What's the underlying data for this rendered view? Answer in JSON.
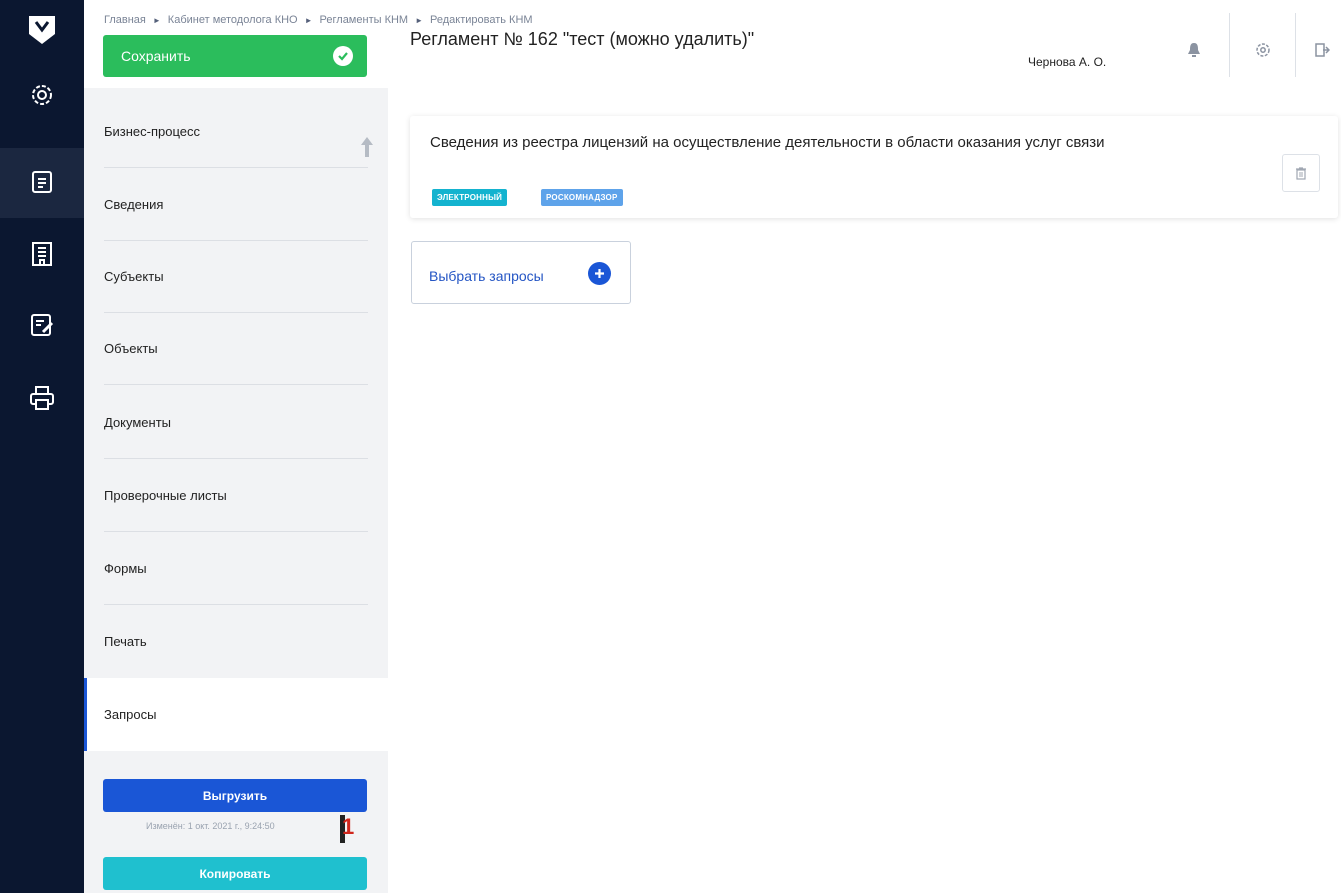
{
  "breadcrumb": [
    "Главная",
    "Кабинет методолога КНО",
    "Регламенты КНМ",
    "Редактировать КНМ"
  ],
  "breadcrumb_separator": "►",
  "header": {
    "save_label": "Сохранить",
    "title": "Регламент № 162 \"тест (можно удалить)\"",
    "user": "Чернова А. О."
  },
  "rail": {
    "items": [
      "logo-icon",
      "settings-icon",
      "document-icon",
      "building-icon",
      "edit-list-icon",
      "print-icon"
    ],
    "active": "document-icon"
  },
  "sections": {
    "items": [
      {
        "label": "Бизнес-процесс"
      },
      {
        "label": "Сведения"
      },
      {
        "label": "Субъекты"
      },
      {
        "label": "Объекты"
      },
      {
        "label": "Документы"
      },
      {
        "label": "Проверочные листы"
      },
      {
        "label": "Формы"
      },
      {
        "label": "Печать"
      },
      {
        "label": "Запросы"
      }
    ],
    "active": "Запросы"
  },
  "actions": {
    "export_label": "Выгрузить",
    "modified": "Изменён: 1 окт. 2021 г., 9:24:50",
    "copy_label": "Копировать"
  },
  "annotation": "1",
  "request": {
    "title": "Сведения из реестра лицензий на осуществление деятельности в области оказания услуг связи",
    "tags": [
      "ЭЛЕКТРОННЫЙ",
      "РОСКОМНАДЗОР"
    ]
  },
  "pick_label": "Выбрать запросы",
  "colors": {
    "rail": "#0b1730",
    "save": "#2bbd5c",
    "primary": "#1a56d6",
    "copy": "#1fc0cf",
    "tag_electronic": "#14b3cf",
    "tag_agency": "#5ea3ea"
  }
}
